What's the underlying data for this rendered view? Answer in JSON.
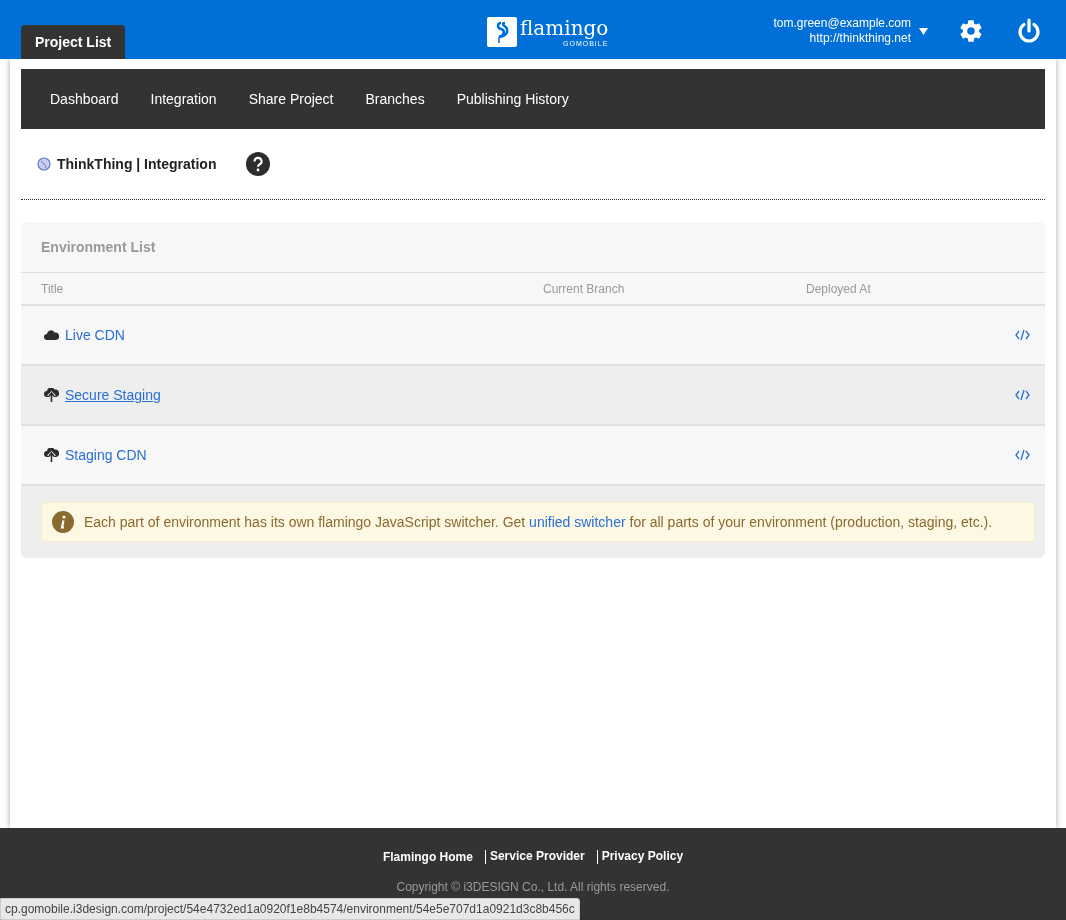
{
  "header": {
    "tab": "Project List",
    "logo": {
      "name": "flamingo",
      "tagline": "GOMOBILE"
    },
    "user": {
      "email": "tom.green@example.com",
      "site": "http://thinkthing.net"
    }
  },
  "nav": [
    "Dashboard",
    "Integration",
    "Share Project",
    "Branches",
    "Publishing History"
  ],
  "breadcrumb": {
    "project": "ThinkThing",
    "separator": "|",
    "page": "Integration"
  },
  "panel": {
    "title": "Environment List",
    "columns": [
      "Title",
      "Current Branch",
      "Deployed At"
    ],
    "rows": [
      {
        "kind": "cloud",
        "title": "Live CDN",
        "hovered": false
      },
      {
        "kind": "upload",
        "title": "Secure Staging",
        "hovered": true
      },
      {
        "kind": "upload",
        "title": "Staging CDN",
        "hovered": false
      }
    ],
    "notice": {
      "before": "Each part of environment has its own flamingo JavaScript switcher. Get ",
      "link": "unified switcher",
      "after": " for all parts of your environment (production, staging, etc.)."
    }
  },
  "footer": {
    "links": [
      "Flamingo Home",
      "Service Provider",
      "Privacy Policy"
    ],
    "copyright": "Copyright © i3DESIGN Co., Ltd. All rights reserved."
  },
  "status_bar": "cp.gomobile.i3design.com/project/54e4732ed1a0920f1e8b4574/environment/54e5e707d1a0921d3c8b456c"
}
